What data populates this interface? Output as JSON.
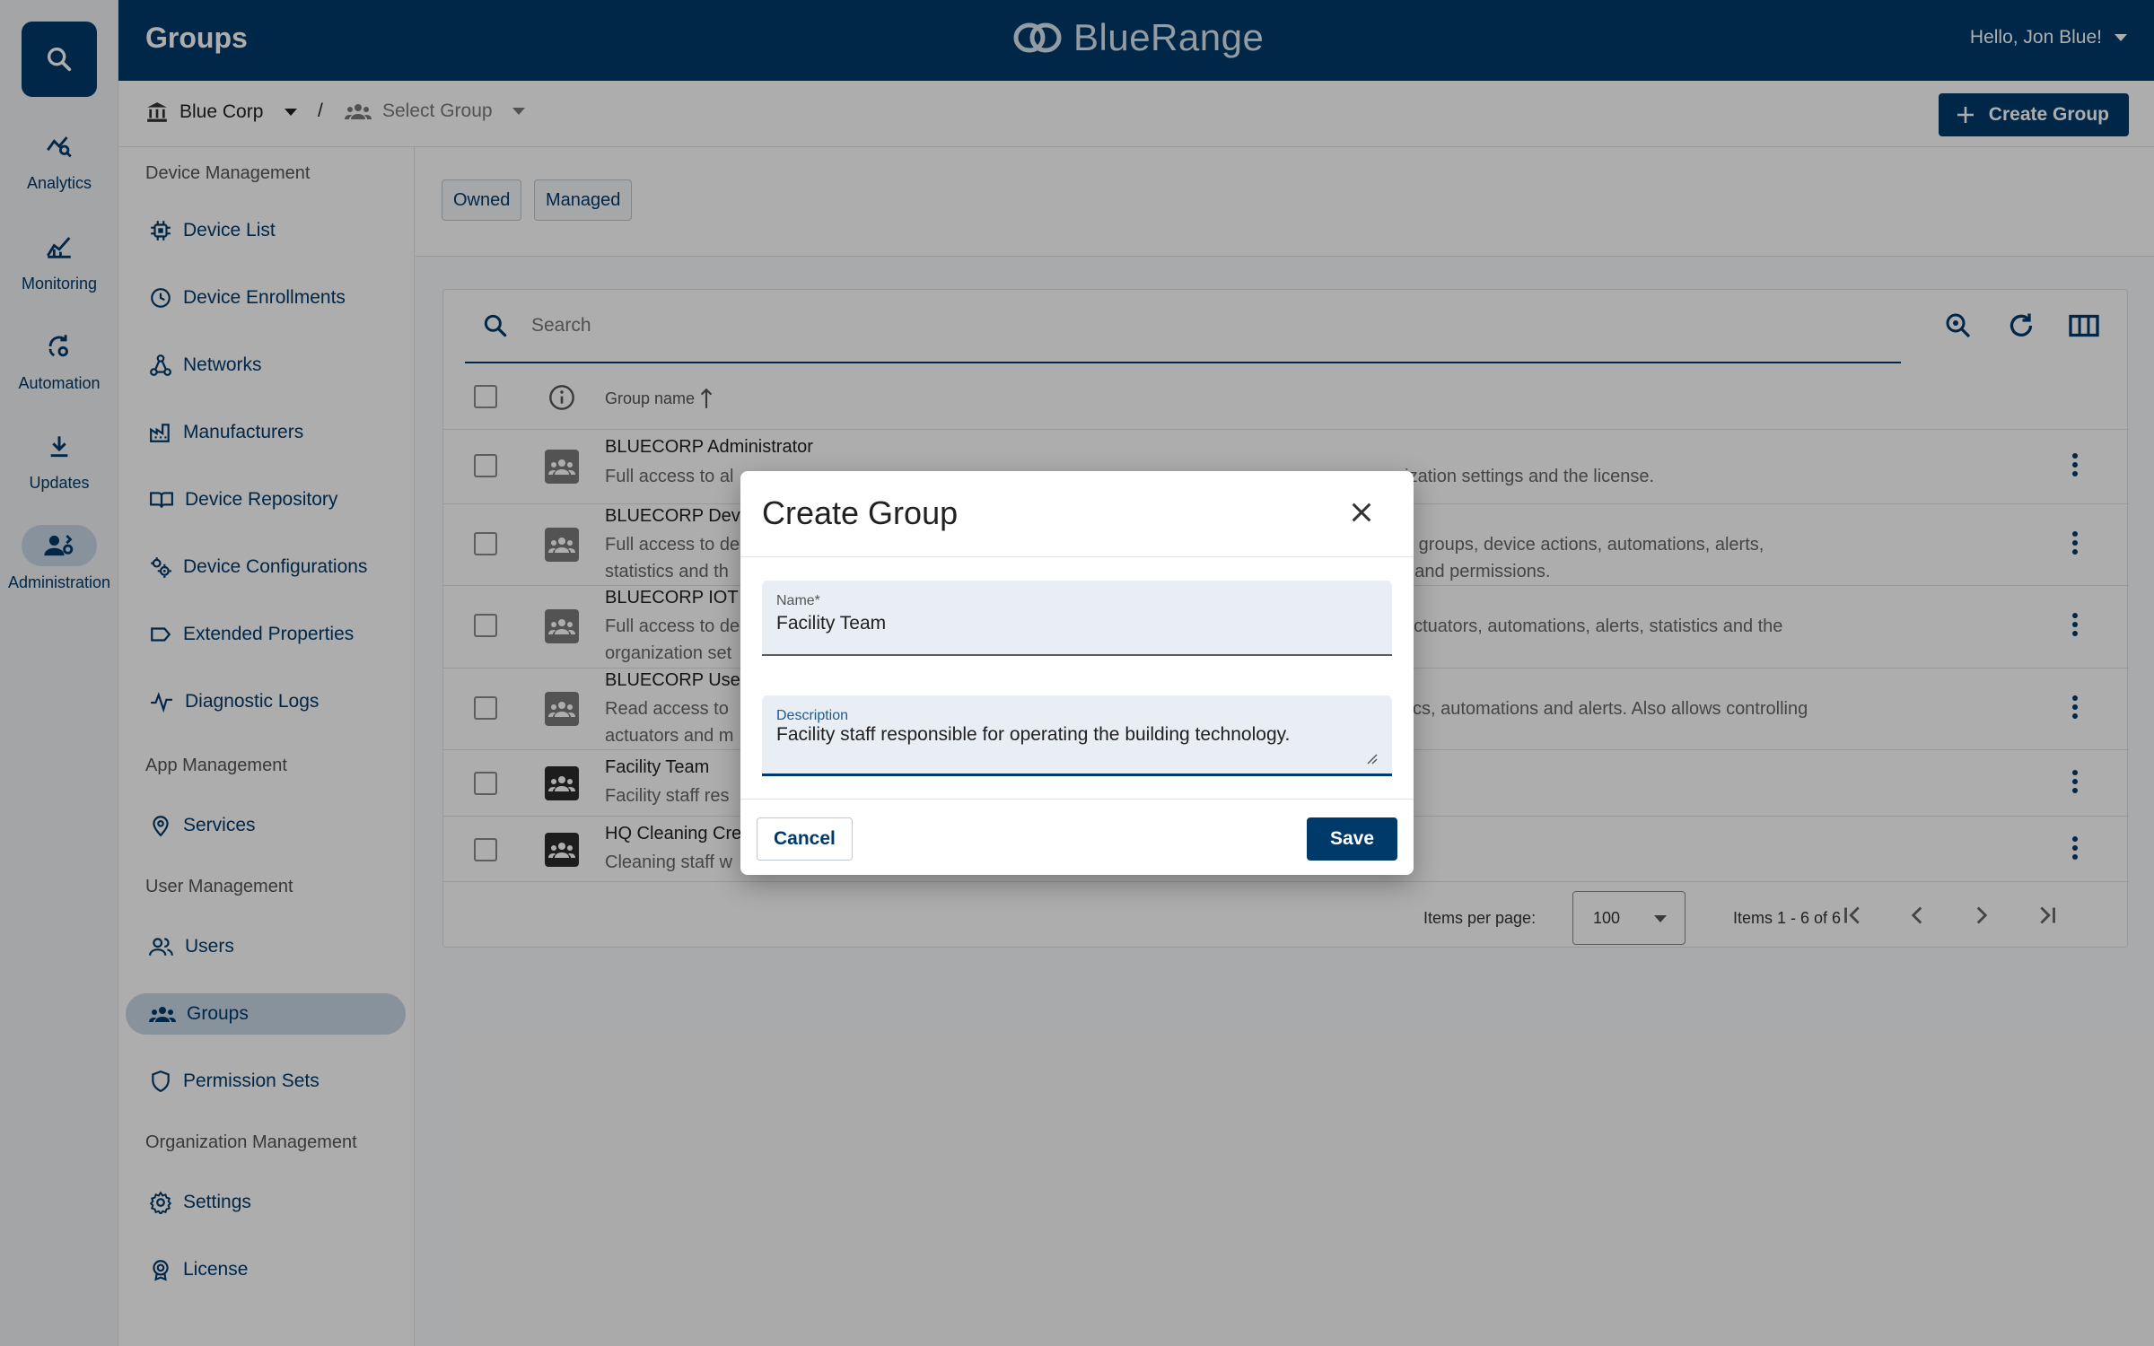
{
  "rail": {
    "items": [
      {
        "label": "Analytics",
        "icon": "analytics-icon"
      },
      {
        "label": "Monitoring",
        "icon": "monitoring-icon"
      },
      {
        "label": "Automation",
        "icon": "automation-icon"
      },
      {
        "label": "Updates",
        "icon": "updates-icon"
      },
      {
        "label": "Administration",
        "icon": "administration-icon",
        "active": true
      }
    ]
  },
  "header": {
    "title": "Groups",
    "brand": "BlueRange",
    "user_greeting": "Hello, Jon Blue!"
  },
  "breadcrumb": {
    "organization": "Blue Corp",
    "separator": "/",
    "group_select": "Select Group"
  },
  "create_group_button": "Create Group",
  "sidebar": {
    "sections": [
      {
        "title": "Device Management",
        "items": [
          "Device List",
          "Device Enrollments",
          "Networks",
          "Manufacturers",
          "Device Repository",
          "Device Configurations",
          "Extended Properties",
          "Diagnostic Logs"
        ]
      },
      {
        "title": "App Management",
        "items": [
          "Services"
        ]
      },
      {
        "title": "User Management",
        "items": [
          "Users",
          "Groups",
          "Permission Sets"
        ]
      },
      {
        "title": "Organization Management",
        "items": [
          "Settings",
          "License"
        ]
      }
    ],
    "active_item": "Groups"
  },
  "filters": {
    "owned": "Owned",
    "managed": "Managed"
  },
  "table": {
    "search_placeholder": "Search",
    "column_group_name": "Group name",
    "sort": "ascending",
    "rows": [
      {
        "name": "BLUECORP Administrator",
        "desc_line1_start": "Full access to al",
        "desc_line1_end": "nization settings and the license.",
        "desc_line2_start": "",
        "desc_line2_end": ""
      },
      {
        "name": "BLUECORP Devi",
        "desc_line1_start": "Full access to de",
        "desc_line1_end": "ce groups, device actions, automations, alerts,",
        "desc_line2_start": "statistics and th",
        "desc_line2_end": "rs and permissions."
      },
      {
        "name": "BLUECORP IOT I",
        "desc_line1_start": "Full access to de",
        "desc_line1_end": "l actuators, automations, alerts, statistics and the",
        "desc_line2_start": "organization set",
        "desc_line2_end": ""
      },
      {
        "name": "BLUECORP User",
        "desc_line1_start": "Read access to",
        "desc_line1_end": "stics, automations and alerts. Also allows controlling",
        "desc_line2_start": "actuators and m",
        "desc_line2_end": ""
      },
      {
        "name": "Facility Team",
        "desc_line1_start": "Facility staff res",
        "desc_line1_end": "",
        "desc_line2_start": "",
        "desc_line2_end": ""
      },
      {
        "name": "HQ Cleaning Cre",
        "desc_line1_start": "Cleaning staff w",
        "desc_line1_end": "",
        "desc_line2_start": "",
        "desc_line2_end": ""
      }
    ]
  },
  "pagination": {
    "items_per_page_label": "Items per page:",
    "items_per_page_value": "100",
    "range": "Items 1 - 6 of 6"
  },
  "dialog": {
    "title": "Create Group",
    "name_label": "Name*",
    "name_value": "Facility Team",
    "description_label": "Description",
    "description_value": "Facility staff responsible for operating the building technology.",
    "cancel": "Cancel",
    "save": "Save"
  },
  "colors": {
    "primary": "#003a6a",
    "active_nav": "#c9d8e8",
    "overlay": "rgba(0,0,0,0.32)"
  }
}
